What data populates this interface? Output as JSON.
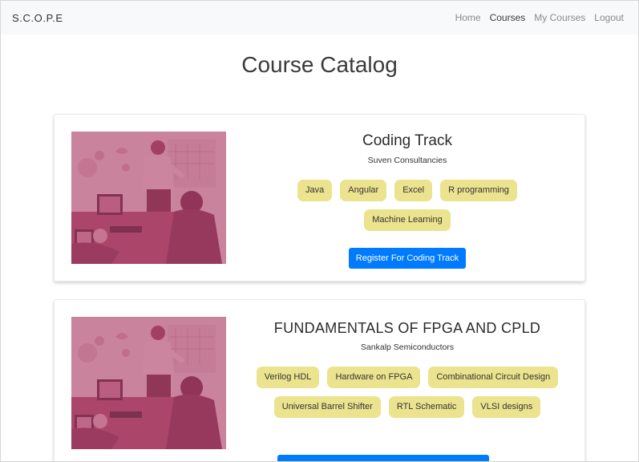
{
  "app": {
    "brand": "S.C.O.P.E"
  },
  "nav": {
    "items": [
      {
        "label": "Home",
        "active": false
      },
      {
        "label": "Courses",
        "active": true
      },
      {
        "label": "My Courses",
        "active": false
      },
      {
        "label": "Logout",
        "active": false
      }
    ]
  },
  "page": {
    "title": "Course Catalog"
  },
  "courses": [
    {
      "title": "Coding Track",
      "provider": "Suven Consultancies",
      "tags": [
        "Java",
        "Angular",
        "Excel",
        "R programming",
        "Machine Learning"
      ],
      "register_label": "Register For Coding Track"
    },
    {
      "title": "FUNDAMENTALS OF FPGA AND CPLD",
      "provider": "Sankalp Semiconductors",
      "tags": [
        "Verilog HDL",
        "Hardware on FPGA",
        "Combinational Circuit Design",
        "Universal Barrel Shifter",
        "RTL Schematic",
        "VLSI designs"
      ]
    }
  ],
  "colors": {
    "tag_bg": "#ece38f",
    "button": "#007bff",
    "image_overlay": "#b0436b"
  },
  "icons": {
    "course_image": "office-team-photo"
  }
}
